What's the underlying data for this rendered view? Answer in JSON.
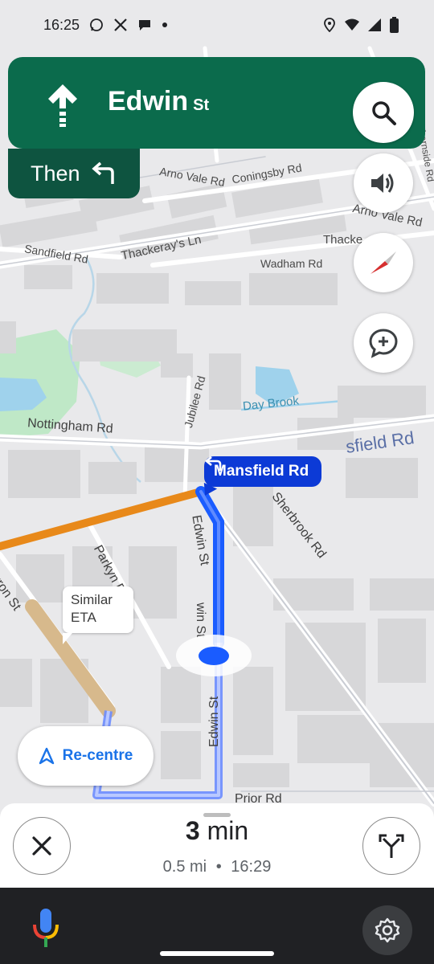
{
  "status_bar": {
    "time": "16:25",
    "left_icons": [
      "whatsapp-icon",
      "x-icon",
      "chat-icon",
      "dot-icon"
    ],
    "right_icons": [
      "location-icon",
      "wifi-icon",
      "signal-icon",
      "battery-icon"
    ]
  },
  "navigation": {
    "street_main": "Edwin",
    "street_suffix": "St",
    "next_label": "Then",
    "turn_callout": "Mansfield Rd"
  },
  "map": {
    "labels": {
      "edwin_st_1": "Edwin St",
      "edwin_st_2": "win St",
      "edwin_st_3": "Edwin St",
      "arno_vale_rd_1": "Arno Vale Rd",
      "arno_vale_rd_2": "Arno Vale Rd",
      "coningsby_rd": "Coningsby Rd",
      "thackerays_ln": "Thackeray's Ln",
      "thacke": "Thacke",
      "sandfield_rd": "Sandfield Rd",
      "wadham_rd": "Wadham Rd",
      "jubilee_rd": "Jubilee Rd",
      "day_brook": "Day Brook",
      "nottingham_rd": "Nottingham Rd",
      "mansfield_rd_fade": "sfield Rd",
      "sherbrook_rd": "Sherbrook Rd",
      "parkyn_rd": "Parkyn Rd",
      "byron_st": "yron St",
      "prior_rd": "Prior Rd",
      "whernside_rd": "Whernside Rd"
    },
    "eta_bubble": [
      "Similar",
      "ETA"
    ],
    "recentre_label": "Re-centre"
  },
  "trip": {
    "duration_num": "3",
    "duration_unit": "min",
    "distance": "0.5 mi",
    "separator": "•",
    "arrival": "16:29"
  },
  "colors": {
    "nav_green": "#0b6b4c",
    "then_green": "#0e5440",
    "route_blue": "#1a5cff",
    "callout_blue": "#0c3ad6",
    "traffic_orange": "#e8891a",
    "recentre_blue": "#1a73e8"
  }
}
